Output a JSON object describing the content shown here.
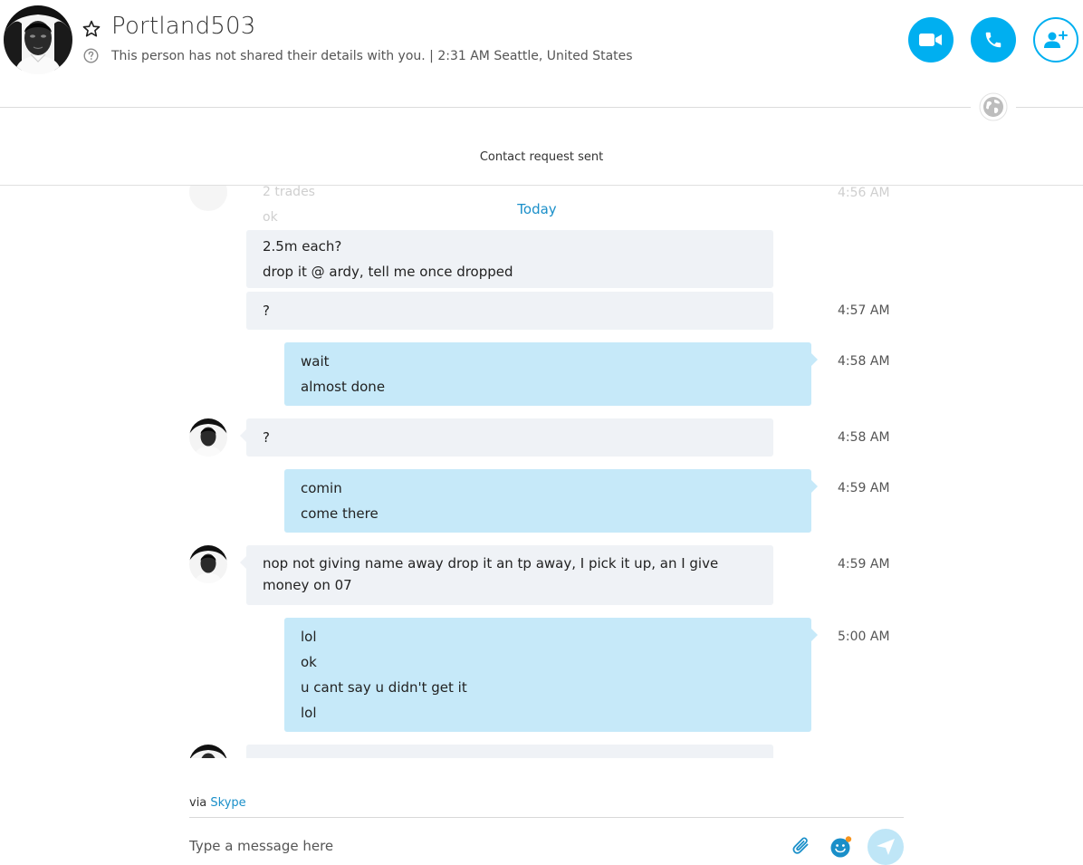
{
  "header": {
    "contact_name": "Portland503",
    "subtitle": "This person has not shared their details with you.  |  2:31 AM Seattle, United States"
  },
  "contact_request": "Contact request sent",
  "ghost_messages": {
    "line1": "2 trades",
    "line2": "ok",
    "time": "4:56 AM"
  },
  "date_separator": "Today",
  "messages": [
    {
      "dir": "in",
      "lines": [
        "2.5m each?",
        "drop it @ ardy, tell me once dropped"
      ],
      "time": ""
    },
    {
      "dir": "in",
      "lines": [
        "?"
      ],
      "time": "4:57 AM"
    },
    {
      "dir": "out",
      "lines": [
        "wait",
        "almost done"
      ],
      "time": "4:58 AM"
    },
    {
      "dir": "in",
      "lines": [
        "?"
      ],
      "time": "4:58 AM"
    },
    {
      "dir": "out",
      "lines": [
        "comin",
        "come there"
      ],
      "time": "4:59 AM"
    },
    {
      "dir": "in",
      "lines": [
        "nop not giving name away drop it an tp away, I pick it up, an  I give money on 07"
      ],
      "time": "4:59 AM"
    },
    {
      "dir": "out",
      "lines": [
        "lol",
        "ok",
        "u cant say u didn't get it",
        "lol"
      ],
      "time": "5:00 AM"
    }
  ],
  "footer": {
    "via_prefix": "via",
    "via_link": "Skype",
    "compose_placeholder": "Type a message here"
  },
  "colors": {
    "accent": "#00aff0",
    "incoming_bubble": "#eff2f6",
    "outgoing_bubble": "#c6e9f9",
    "link": "#1a8fc9"
  }
}
